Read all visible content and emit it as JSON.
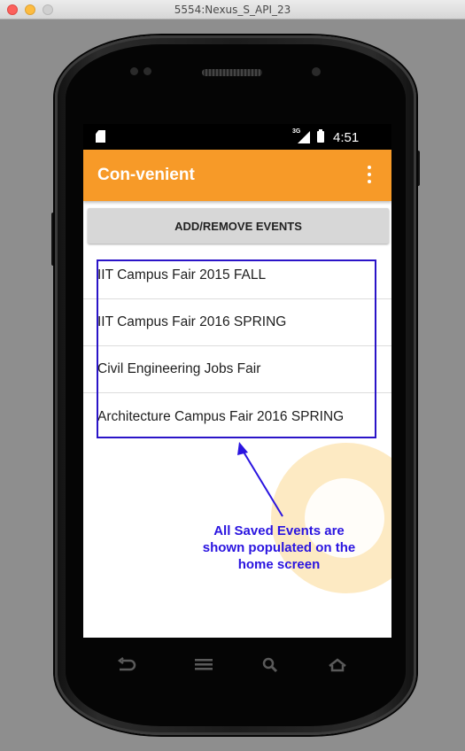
{
  "window": {
    "title": "5554:Nexus_S_API_23"
  },
  "statusbar": {
    "network": "3G",
    "time": "4:51"
  },
  "appbar": {
    "title": "Con-venient",
    "menu_icon": "overflow-menu-icon"
  },
  "actions": {
    "add_remove_label": "ADD/REMOVE EVENTS"
  },
  "events": [
    "IIT Campus Fair 2015 FALL",
    "IIT Campus Fair 2016 SPRING",
    "Civil Engineering Jobs Fair",
    "Architecture Campus Fair 2016 SPRING"
  ],
  "annotation": {
    "line1": "All Saved Events are",
    "line2": "shown populated on the",
    "line3": "home screen",
    "color": "#2a14e0"
  },
  "colors": {
    "appbar": "#f79a28",
    "window_bg": "#8e8e8e"
  },
  "navbar": {
    "icons": [
      "back-icon",
      "menu-icon",
      "search-icon",
      "home-icon"
    ]
  }
}
